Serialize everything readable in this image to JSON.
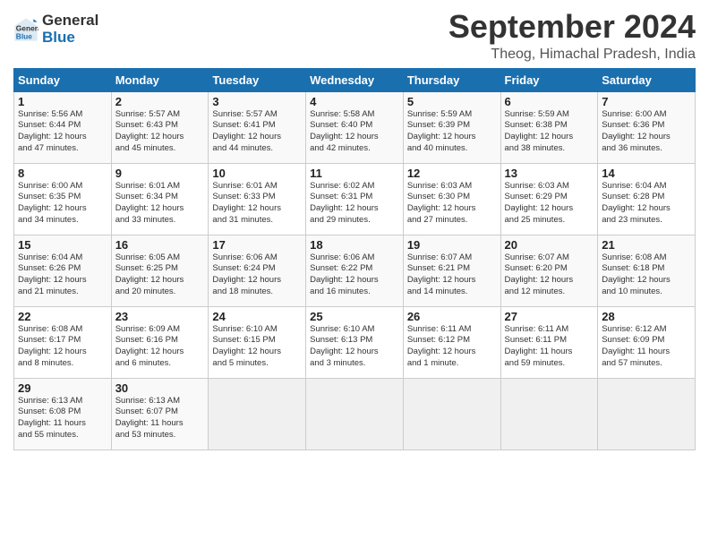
{
  "logo": {
    "text_line1": "General",
    "text_line2": "Blue"
  },
  "title": "September 2024",
  "subtitle": "Theog, Himachal Pradesh, India",
  "weekdays": [
    "Sunday",
    "Monday",
    "Tuesday",
    "Wednesday",
    "Thursday",
    "Friday",
    "Saturday"
  ],
  "weeks": [
    [
      {
        "day": "1",
        "info": "Sunrise: 5:56 AM\nSunset: 6:44 PM\nDaylight: 12 hours\nand 47 minutes."
      },
      {
        "day": "2",
        "info": "Sunrise: 5:57 AM\nSunset: 6:43 PM\nDaylight: 12 hours\nand 45 minutes."
      },
      {
        "day": "3",
        "info": "Sunrise: 5:57 AM\nSunset: 6:41 PM\nDaylight: 12 hours\nand 44 minutes."
      },
      {
        "day": "4",
        "info": "Sunrise: 5:58 AM\nSunset: 6:40 PM\nDaylight: 12 hours\nand 42 minutes."
      },
      {
        "day": "5",
        "info": "Sunrise: 5:59 AM\nSunset: 6:39 PM\nDaylight: 12 hours\nand 40 minutes."
      },
      {
        "day": "6",
        "info": "Sunrise: 5:59 AM\nSunset: 6:38 PM\nDaylight: 12 hours\nand 38 minutes."
      },
      {
        "day": "7",
        "info": "Sunrise: 6:00 AM\nSunset: 6:36 PM\nDaylight: 12 hours\nand 36 minutes."
      }
    ],
    [
      {
        "day": "8",
        "info": "Sunrise: 6:00 AM\nSunset: 6:35 PM\nDaylight: 12 hours\nand 34 minutes."
      },
      {
        "day": "9",
        "info": "Sunrise: 6:01 AM\nSunset: 6:34 PM\nDaylight: 12 hours\nand 33 minutes."
      },
      {
        "day": "10",
        "info": "Sunrise: 6:01 AM\nSunset: 6:33 PM\nDaylight: 12 hours\nand 31 minutes."
      },
      {
        "day": "11",
        "info": "Sunrise: 6:02 AM\nSunset: 6:31 PM\nDaylight: 12 hours\nand 29 minutes."
      },
      {
        "day": "12",
        "info": "Sunrise: 6:03 AM\nSunset: 6:30 PM\nDaylight: 12 hours\nand 27 minutes."
      },
      {
        "day": "13",
        "info": "Sunrise: 6:03 AM\nSunset: 6:29 PM\nDaylight: 12 hours\nand 25 minutes."
      },
      {
        "day": "14",
        "info": "Sunrise: 6:04 AM\nSunset: 6:28 PM\nDaylight: 12 hours\nand 23 minutes."
      }
    ],
    [
      {
        "day": "15",
        "info": "Sunrise: 6:04 AM\nSunset: 6:26 PM\nDaylight: 12 hours\nand 21 minutes."
      },
      {
        "day": "16",
        "info": "Sunrise: 6:05 AM\nSunset: 6:25 PM\nDaylight: 12 hours\nand 20 minutes."
      },
      {
        "day": "17",
        "info": "Sunrise: 6:06 AM\nSunset: 6:24 PM\nDaylight: 12 hours\nand 18 minutes."
      },
      {
        "day": "18",
        "info": "Sunrise: 6:06 AM\nSunset: 6:22 PM\nDaylight: 12 hours\nand 16 minutes."
      },
      {
        "day": "19",
        "info": "Sunrise: 6:07 AM\nSunset: 6:21 PM\nDaylight: 12 hours\nand 14 minutes."
      },
      {
        "day": "20",
        "info": "Sunrise: 6:07 AM\nSunset: 6:20 PM\nDaylight: 12 hours\nand 12 minutes."
      },
      {
        "day": "21",
        "info": "Sunrise: 6:08 AM\nSunset: 6:18 PM\nDaylight: 12 hours\nand 10 minutes."
      }
    ],
    [
      {
        "day": "22",
        "info": "Sunrise: 6:08 AM\nSunset: 6:17 PM\nDaylight: 12 hours\nand 8 minutes."
      },
      {
        "day": "23",
        "info": "Sunrise: 6:09 AM\nSunset: 6:16 PM\nDaylight: 12 hours\nand 6 minutes."
      },
      {
        "day": "24",
        "info": "Sunrise: 6:10 AM\nSunset: 6:15 PM\nDaylight: 12 hours\nand 5 minutes."
      },
      {
        "day": "25",
        "info": "Sunrise: 6:10 AM\nSunset: 6:13 PM\nDaylight: 12 hours\nand 3 minutes."
      },
      {
        "day": "26",
        "info": "Sunrise: 6:11 AM\nSunset: 6:12 PM\nDaylight: 12 hours\nand 1 minute."
      },
      {
        "day": "27",
        "info": "Sunrise: 6:11 AM\nSunset: 6:11 PM\nDaylight: 11 hours\nand 59 minutes."
      },
      {
        "day": "28",
        "info": "Sunrise: 6:12 AM\nSunset: 6:09 PM\nDaylight: 11 hours\nand 57 minutes."
      }
    ],
    [
      {
        "day": "29",
        "info": "Sunrise: 6:13 AM\nSunset: 6:08 PM\nDaylight: 11 hours\nand 55 minutes."
      },
      {
        "day": "30",
        "info": "Sunrise: 6:13 AM\nSunset: 6:07 PM\nDaylight: 11 hours\nand 53 minutes."
      },
      {
        "day": "",
        "info": ""
      },
      {
        "day": "",
        "info": ""
      },
      {
        "day": "",
        "info": ""
      },
      {
        "day": "",
        "info": ""
      },
      {
        "day": "",
        "info": ""
      }
    ]
  ]
}
